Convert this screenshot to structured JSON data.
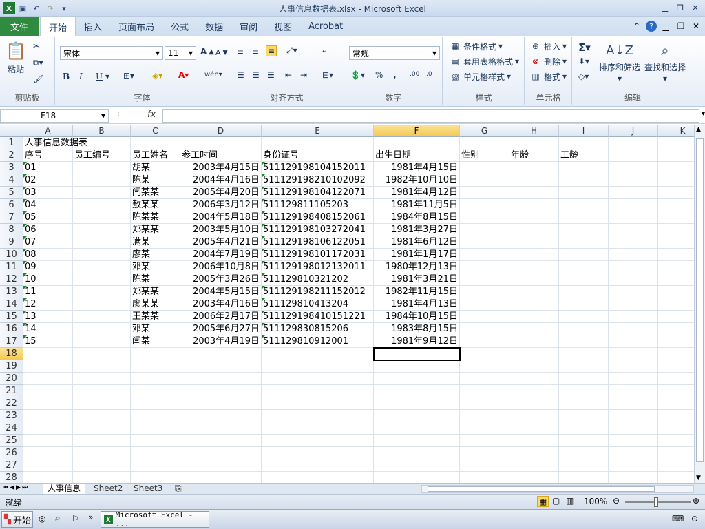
{
  "window": {
    "title": "人事信息数据表.xlsx  -  Microsoft Excel"
  },
  "ribbon_tabs": {
    "file": "文件",
    "tabs": [
      "开始",
      "插入",
      "页面布局",
      "公式",
      "数据",
      "审阅",
      "视图",
      "Acrobat"
    ]
  },
  "ribbon": {
    "clipboard": {
      "label": "剪贴板",
      "paste": "粘贴"
    },
    "font": {
      "label": "字体",
      "name": "宋体",
      "size": "11",
      "bold": "B",
      "italic": "I",
      "underline": "U"
    },
    "alignment": {
      "label": "对齐方式"
    },
    "number": {
      "label": "数字",
      "format": "常规",
      "percent": "%",
      "comma": ","
    },
    "styles": {
      "label": "样式",
      "conditional": "条件格式",
      "table": "套用表格格式",
      "cell": "单元格样式"
    },
    "cells": {
      "label": "单元格",
      "insert": "插入",
      "delete": "删除",
      "format": "格式"
    },
    "editing": {
      "label": "编辑",
      "sort": "排序和筛选",
      "find": "查找和选择"
    }
  },
  "formula_bar": {
    "name_box": "F18",
    "fx": "fx",
    "formula": ""
  },
  "columns": [
    "A",
    "B",
    "C",
    "D",
    "E",
    "F",
    "G",
    "H",
    "I",
    "J",
    "K"
  ],
  "rows": [
    "1",
    "2",
    "3",
    "4",
    "5",
    "6",
    "7",
    "8",
    "9",
    "10",
    "11",
    "12",
    "13",
    "14",
    "15",
    "16",
    "17",
    "18",
    "19",
    "20",
    "21",
    "22",
    "23",
    "24",
    "25",
    "26",
    "27",
    "28"
  ],
  "sheet": {
    "title": "人事信息数据表",
    "headers": [
      "序号",
      "员工编号",
      "员工姓名",
      "参工时间",
      "身份证号",
      "出生日期",
      "性别",
      "年龄",
      "工龄"
    ],
    "records": [
      [
        "01",
        "",
        "胡某",
        "2003年4月15日",
        "511129198104152011",
        "1981年4月15日"
      ],
      [
        "02",
        "",
        "陈某",
        "2004年4月16日",
        "511129198210102092",
        "1982年10月10日"
      ],
      [
        "03",
        "",
        "闫某某",
        "2005年4月20日",
        "511129198104122071",
        "1981年4月12日"
      ],
      [
        "04",
        "",
        "敖某某",
        "2006年3月12日",
        "511129811105203",
        "1981年11月5日"
      ],
      [
        "05",
        "",
        "陈某某",
        "2004年5月18日",
        "511129198408152061",
        "1984年8月15日"
      ],
      [
        "06",
        "",
        "郑某某",
        "2003年5月10日",
        "511129198103272041",
        "1981年3月27日"
      ],
      [
        "07",
        "",
        "满某",
        "2005年4月21日",
        "511129198106122051",
        "1981年6月12日"
      ],
      [
        "08",
        "",
        "廖某",
        "2004年7月19日",
        "511129198101172031",
        "1981年1月17日"
      ],
      [
        "09",
        "",
        "邓某",
        "2006年10月8日",
        "511129198012132011",
        "1980年12月13日"
      ],
      [
        "10",
        "",
        "陈某",
        "2005年3月26日",
        "511129810321202",
        "1981年3月21日"
      ],
      [
        "11",
        "",
        "郑某某",
        "2004年5月15日",
        "511129198211152012",
        "1982年11月15日"
      ],
      [
        "12",
        "",
        "廖某某",
        "2003年4月16日",
        "511129810413204",
        "1981年4月13日"
      ],
      [
        "13",
        "",
        "王某某",
        "2006年2月17日",
        "511129198410151221",
        "1984年10月15日"
      ],
      [
        "14",
        "",
        "邓某",
        "2005年6月27日",
        "511129830815206",
        "1983年8月15日"
      ],
      [
        "15",
        "",
        "闫某",
        "2003年4月19日",
        "511129810912001",
        "1981年9月12日"
      ]
    ]
  },
  "sheet_tabs": [
    "人事信息",
    "Sheet2",
    "Sheet3"
  ],
  "status": {
    "ready": "就绪",
    "zoom": "100%"
  },
  "taskbar": {
    "start": "开始",
    "app": "Microsoft Excel - ..."
  },
  "colors": {
    "file_tab": "#2e8b3f",
    "selection_header": "#f3c94f",
    "text_marker": "#1a8a2e"
  }
}
